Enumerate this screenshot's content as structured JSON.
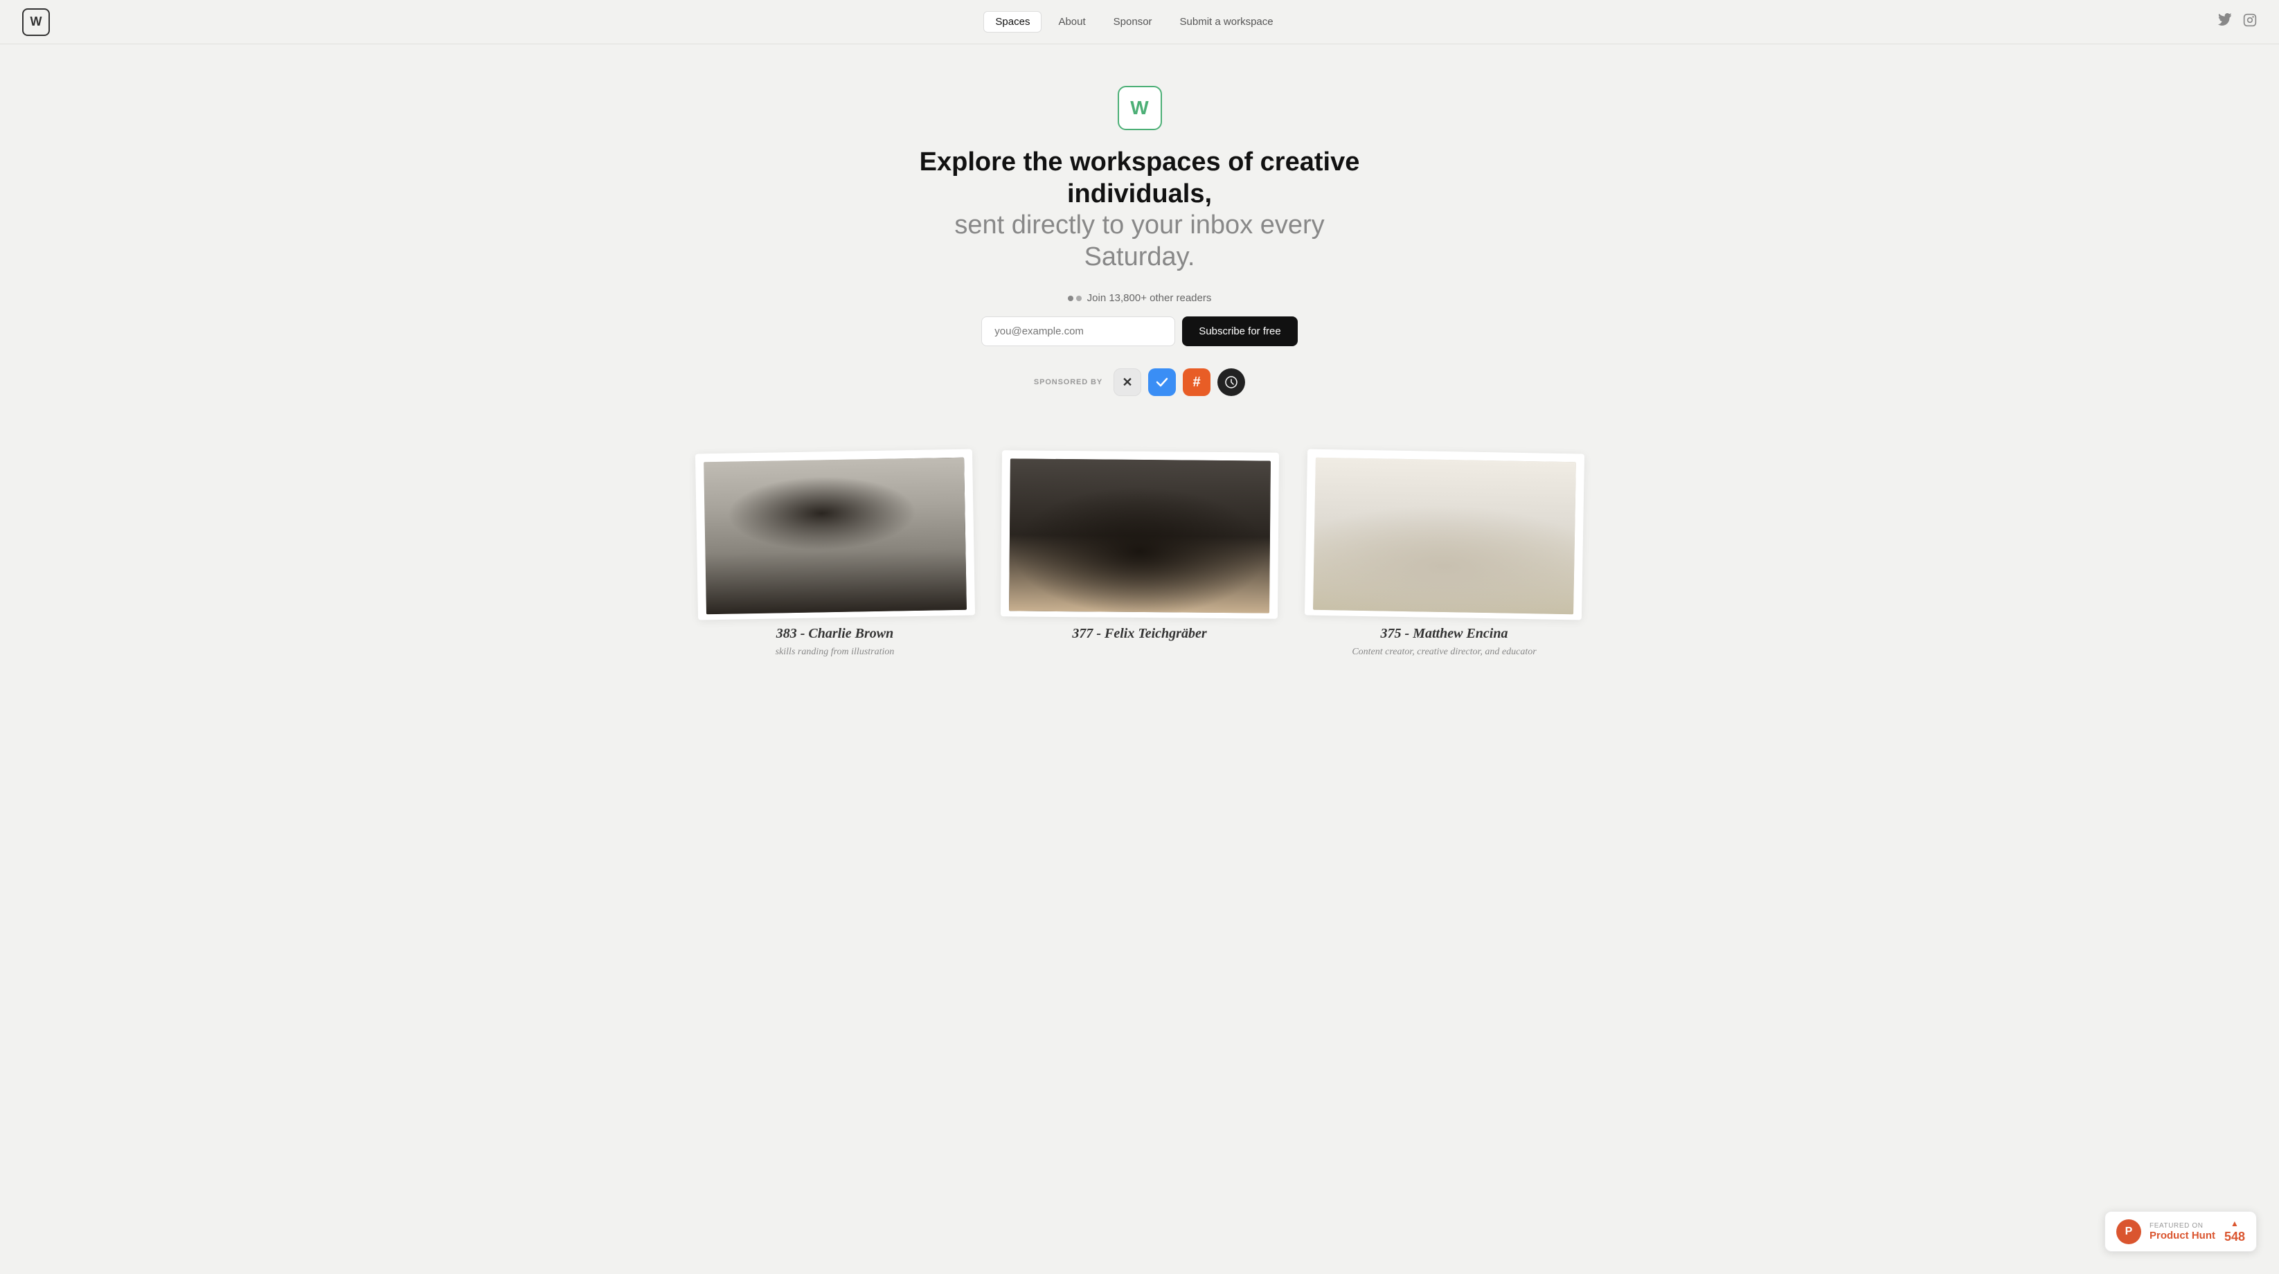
{
  "site": {
    "logo_letter": "W",
    "name": "Workspaces"
  },
  "nav": {
    "links": [
      {
        "id": "spaces",
        "label": "Spaces",
        "active": true
      },
      {
        "id": "about",
        "label": "About",
        "active": false
      },
      {
        "id": "sponsor",
        "label": "Sponsor",
        "active": false
      },
      {
        "id": "submit",
        "label": "Submit a workspace",
        "active": false
      }
    ],
    "twitter_label": "Twitter",
    "instagram_label": "Instagram"
  },
  "hero": {
    "logo_letter": "W",
    "title_line1": "Explore the workspaces of creative individuals,",
    "title_line2": "sent directly to your inbox every Saturday.",
    "readers_text": "Join 13,800+ other readers",
    "email_placeholder": "you@example.com",
    "subscribe_label": "Subscribe for free"
  },
  "sponsored": {
    "label": "SPONSORED BY",
    "sponsors": [
      {
        "id": "kaspersky",
        "symbol": "✕",
        "bg": "#e8e8e8",
        "color": "#333",
        "border": true
      },
      {
        "id": "paste",
        "symbol": "✓",
        "bg": "#3a8ef5",
        "color": "#fff",
        "border": false
      },
      {
        "id": "hazeover",
        "symbol": "#",
        "bg": "#e85d26",
        "color": "#fff",
        "border": false
      },
      {
        "id": "pricetag",
        "symbol": "⊕",
        "bg": "#1a1a1a",
        "color": "#fff",
        "border": false
      }
    ]
  },
  "cards": [
    {
      "id": "card-383",
      "number": "383",
      "name": "Charlie Brown",
      "description": "skills randing from illustration",
      "image_class": "workspace-1"
    },
    {
      "id": "card-377",
      "number": "377",
      "name": "Felix Teichgräber",
      "description": "",
      "image_class": "workspace-2"
    },
    {
      "id": "card-375",
      "number": "375",
      "name": "Matthew Encina",
      "description": "Content creator, creative director, and educator",
      "image_class": "workspace-3"
    }
  ],
  "product_hunt": {
    "featured_label": "FEATURED ON",
    "name": "Product Hunt",
    "count": "548",
    "logo": "P"
  }
}
